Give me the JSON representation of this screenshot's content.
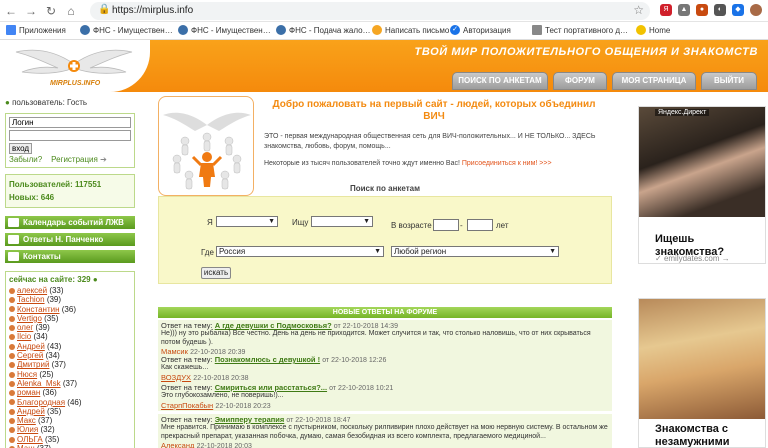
{
  "browser": {
    "url": "https://mirplus.info",
    "bookmarks": [
      "Приложения",
      "ФНС - Имуществен…",
      "ФНС - Имуществен…",
      "ФНС - Подача жало…",
      "Написать письмо",
      "Авторизация",
      "Тест портативного д…",
      "Home"
    ]
  },
  "header": {
    "slogan": "ТВОЙ МИР ПОЛОЖИТЕЛЬНОГО ОБЩЕНИЯ И ЗНАКОМСТВ",
    "logo_text": "MIRPLUS.INFO",
    "tabs": [
      "ПОИСК ПО АНКЕТАМ",
      "ФОРУМ",
      "МОЯ СТРАНИЦА",
      "ВЫЙТИ"
    ]
  },
  "sidebar": {
    "user_label": "пользователь: Гость",
    "login_placeholder": "Логин",
    "enter_label": "вход",
    "forgot_label": "Забыли?",
    "register_label": "Регистрация",
    "users_count": "Пользователей: 117551",
    "new_count": "Новых: 646",
    "buttons": [
      "Календарь событий ЛЖВ",
      "Ответы Н. Панченко",
      "Контакты"
    ],
    "online_title": "сейчас на сайте: 329",
    "online": [
      {
        "name": "алексей",
        "age": "(33)"
      },
      {
        "name": "Tachion",
        "age": "(39)"
      },
      {
        "name": "Константин",
        "age": "(36)"
      },
      {
        "name": "Vertigo",
        "age": "(35)"
      },
      {
        "name": "олег",
        "age": "(39)"
      },
      {
        "name": "Ilcio",
        "age": "(34)"
      },
      {
        "name": "Андрей",
        "age": "(43)"
      },
      {
        "name": "Сергей",
        "age": "(34)"
      },
      {
        "name": "Дмитрий",
        "age": "(37)"
      },
      {
        "name": "Нюся",
        "age": "(25)"
      },
      {
        "name": "Alenka_Msk",
        "age": "(37)"
      },
      {
        "name": "роман",
        "age": "(36)"
      },
      {
        "name": "Благородная",
        "age": "(46)"
      },
      {
        "name": "Андрей",
        "age": "(35)"
      },
      {
        "name": "Макс",
        "age": "(37)"
      },
      {
        "name": "Юлия",
        "age": "(32)"
      },
      {
        "name": "ОЛЬГА",
        "age": "(35)"
      },
      {
        "name": "Маш",
        "age": "(37)"
      }
    ]
  },
  "welcome": {
    "title": "Добро пожаловать на первый сайт - людей, которых объединил ВИЧ",
    "text": "ЭТО - первая международная общественная сеть для ВИЧ-положительных... И НЕ ТОЛЬКО... ЗДЕСЬ знакомства, любовь, форум, помощь...",
    "text2": "Некоторые из тысяч пользователей точно ждут именно Вас!",
    "join_link": "Присоединиться к ним! >>>"
  },
  "search": {
    "title": "Поиск по анкетам",
    "i_label": "Я",
    "seek_label": "Ищу",
    "age_label": "В возрасте",
    "dash": "-",
    "years_label": "лет",
    "where_label": "Где",
    "country": "Россия",
    "region": "Любой регион",
    "button": "искать"
  },
  "forum": {
    "header": "НОВЫЕ ОТВЕТЫ НА ФОРУМЕ",
    "prefix": "Ответ на тему:",
    "items": [
      {
        "topic": "А где девушки с Подмосковья?",
        "date": "от 22-10-2018 14:39",
        "text": "Не))) ну это рыбалка) Все честно. День на день не приходится. Может случится и так, что столько наловишь, что от них скрываться потом будешь ).",
        "author": "Мамсик",
        "author_date": "22-10-2018 20:39"
      },
      {
        "topic": "Познакомлюсь с девушкой !",
        "date": "от 22-10-2018 12:26",
        "text": "Как скажешь...",
        "author": "ВОЗДУХ",
        "author_date": "22-10-2018 20:38"
      },
      {
        "topic": "Смириться или расстаться?...",
        "date": "от 22-10-2018 10:21",
        "text": "Это глубокозамлено, не поверишь!)...",
        "author": "СтарпПокабын",
        "author_date": "22-10-2018 20:23"
      },
      {
        "topic": "Эмипперу терапия",
        "date": "от 22-10-2018 18:47",
        "text": "Мне нравится. Принимаю в комплексе с пустырником, поскольку рилпивирин плохо действует на мою нервную систему. В остальном же прекрасный препарат, указанная побочка, думаю, самая безобидная из всего комплекта, предлагаемого медициной...",
        "author": "Александ",
        "author_date": "22-10-2018 20:03"
      }
    ]
  },
  "ads": {
    "label": "Яндекс.Директ",
    "ad1_title": "Ищешь знакомства?",
    "ad1_domain": "emilydates.com",
    "ad2_title": "Знакомства с незамужними"
  },
  "colors": {
    "header_orange": "#f58a0c",
    "green": "#76b428",
    "link_red": "#c84a10"
  }
}
